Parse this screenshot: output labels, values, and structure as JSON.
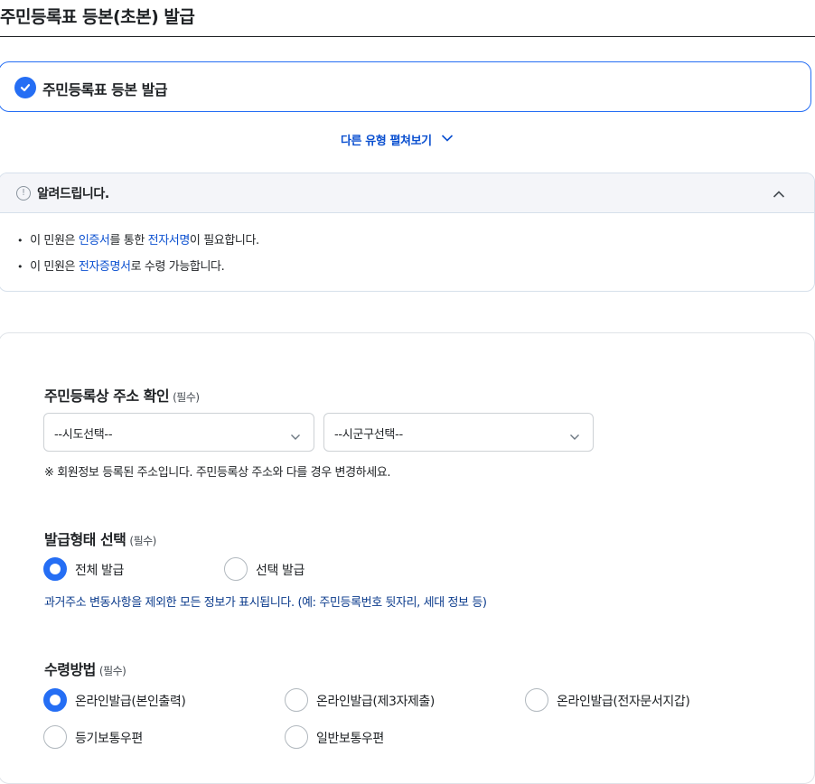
{
  "page": {
    "title": "주민등록표 등본(초본) 발급"
  },
  "selected_type": {
    "label": "주민등록표 등본 발급",
    "accent": "#256ef4"
  },
  "expand": {
    "label": "다른 유형 펼쳐보기"
  },
  "notice": {
    "title": "알려드립니다.",
    "items": [
      {
        "pre": "이 민원은 ",
        "hl1": "인증서",
        "mid": "를 통한 ",
        "hl2": "전자서명",
        "post": "이 필요합니다."
      },
      {
        "pre": "이 민원은 ",
        "hl1": "전자증명서",
        "post": "로 수령 가능합니다."
      }
    ]
  },
  "address": {
    "label": "주민등록상 주소 확인",
    "required": "(필수)",
    "sido_value": "--시도선택--",
    "sigungu_value": "--시군구선택--",
    "note": "※ 회원정보 등록된 주소입니다. 주민등록상 주소와 다를 경우 변경하세요."
  },
  "issue_type": {
    "label": "발급형태 선택",
    "required": "(필수)",
    "options": [
      {
        "label": "전체 발급",
        "checked": true
      },
      {
        "label": "선택 발급",
        "checked": false
      }
    ],
    "note": "과거주소 변동사항을 제외한 모든 정보가 표시됩니다. (예: 주민등록번호 뒷자리, 세대 정보 등)"
  },
  "receive": {
    "label": "수령방법",
    "required": "(필수)",
    "options": [
      {
        "label": "온라인발급(본인출력)",
        "checked": true
      },
      {
        "label": "온라인발급(제3자제출)",
        "checked": false
      },
      {
        "label": "온라인발급(전자문서지갑)",
        "checked": false
      },
      {
        "label": "등기보통우편",
        "checked": false
      },
      {
        "label": "일반보통우편",
        "checked": false
      }
    ]
  }
}
